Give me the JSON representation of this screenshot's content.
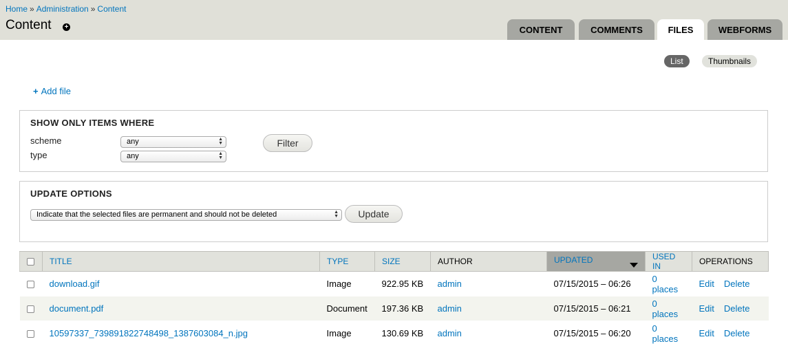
{
  "breadcrumb": {
    "items": [
      "Home",
      "Administration",
      "Content"
    ],
    "separator": "»"
  },
  "page": {
    "title": "Content"
  },
  "tabs": [
    "CONTENT",
    "COMMENTS",
    "FILES",
    "WEBFORMS"
  ],
  "view_tabs": {
    "list": "List",
    "thumbnails": "Thumbnails"
  },
  "add_file": "Add file",
  "filter": {
    "legend": "SHOW ONLY ITEMS WHERE",
    "scheme_label": "scheme",
    "scheme_value": "any",
    "type_label": "type",
    "type_value": "any",
    "button": "Filter"
  },
  "update": {
    "legend": "UPDATE OPTIONS",
    "option": "Indicate that the selected files are permanent and should not be deleted",
    "button": "Update"
  },
  "table": {
    "headers": {
      "title": "TITLE",
      "type": "TYPE",
      "size": "SIZE",
      "author": "AUTHOR",
      "updated": "UPDATED",
      "used_in": "USED IN",
      "operations": "OPERATIONS"
    },
    "rows": [
      {
        "title": "download.gif",
        "type": "Image",
        "size": "922.95 KB",
        "author": "admin",
        "updated": "07/15/2015 – 06:26",
        "used_in": "0 places",
        "edit": "Edit",
        "delete": "Delete"
      },
      {
        "title": "document.pdf",
        "type": "Document",
        "size": "197.36 KB",
        "author": "admin",
        "updated": "07/15/2015 – 06:21",
        "used_in": "0 places",
        "edit": "Edit",
        "delete": "Delete"
      },
      {
        "title": "10597337_739891822748498_1387603084_n.jpg",
        "type": "Image",
        "size": "130.69 KB",
        "author": "admin",
        "updated": "07/15/2015 – 06:20",
        "used_in": "0 places",
        "edit": "Edit",
        "delete": "Delete"
      }
    ]
  },
  "colors": {
    "link": "#0074bd",
    "header_bg": "#e0e0d8",
    "tab_bg": "#a6a7a2"
  }
}
